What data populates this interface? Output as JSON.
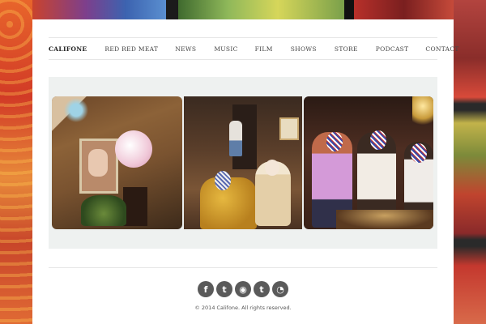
{
  "nav": {
    "brand": "CALIFONE",
    "items": [
      "RED RED MEAT",
      "NEWS",
      "MUSIC",
      "FILM",
      "SHOWS",
      "STORE",
      "PODCAST",
      "CONTACT"
    ]
  },
  "slider": {
    "photos": [
      "photo-living-room",
      "photo-couple-on-couch",
      "photo-masked-party"
    ]
  },
  "social": {
    "icons": [
      "facebook-icon",
      "twitter-icon",
      "instagram-icon",
      "tumblr-icon",
      "rss-icon"
    ],
    "glyphs": [
      "f",
      "t",
      "◉",
      "t",
      "◔"
    ]
  },
  "footer": {
    "copyright": "© 2014 Califone. All rights reserved."
  },
  "colors": {
    "card": "#ffffff",
    "slider_bg": "#eef1f0",
    "icon_bg": "#5a5a5a"
  }
}
